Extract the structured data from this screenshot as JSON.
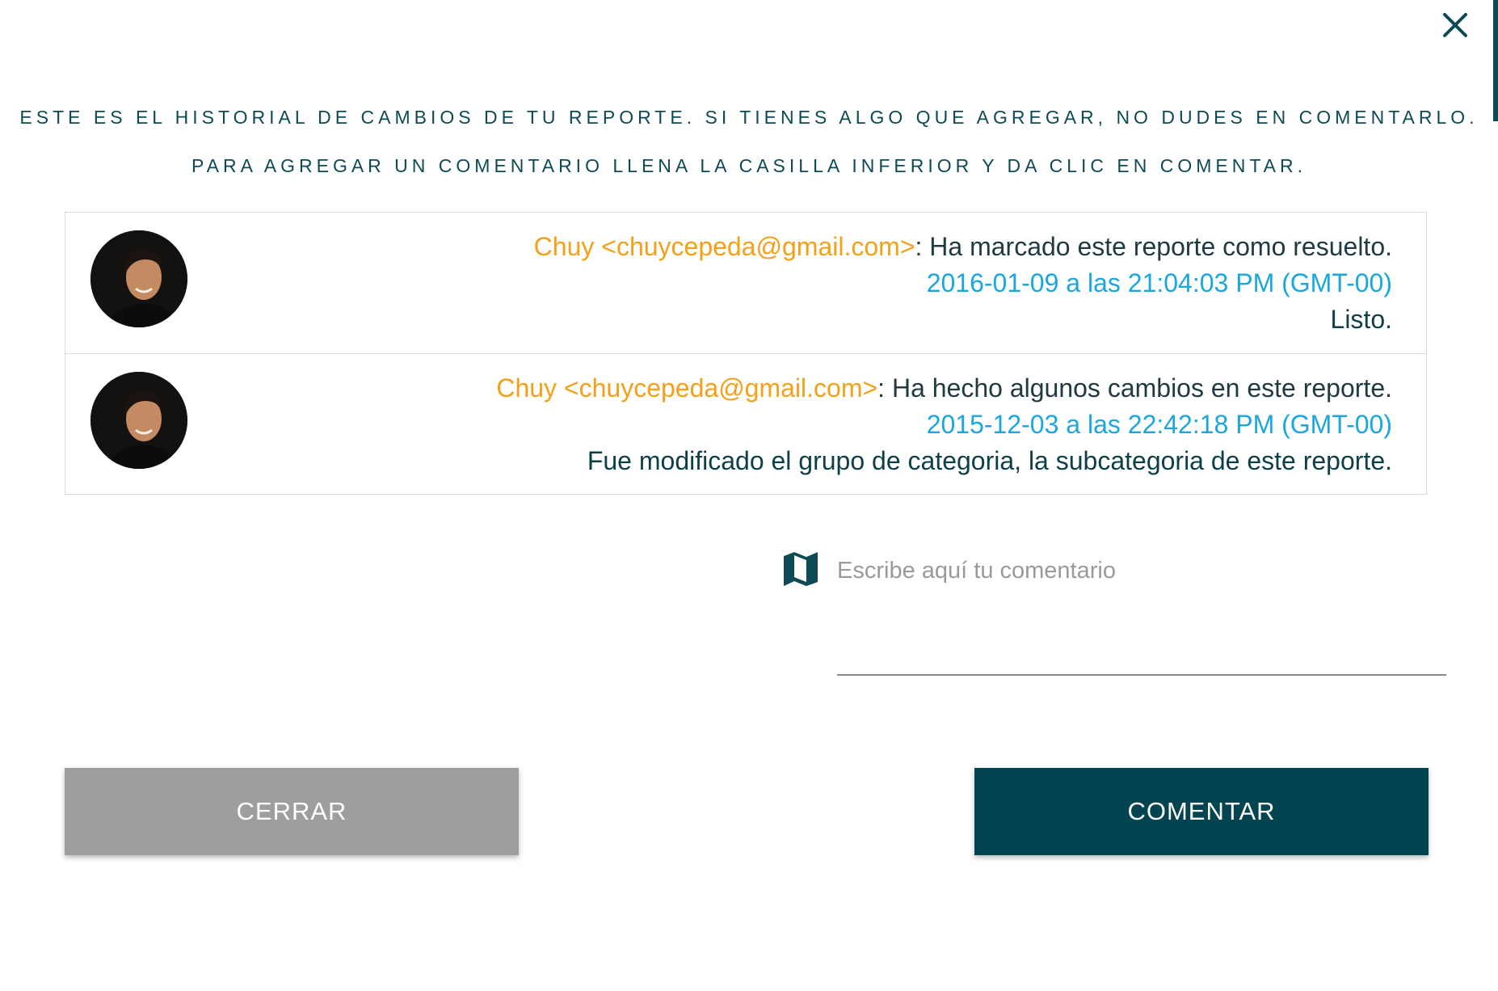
{
  "intro": {
    "line1": "ESTE ES EL HISTORIAL DE CAMBIOS DE TU REPORTE. SI TIENES ALGO QUE AGREGAR, NO DUDES EN COMENTARLO.",
    "line2": "PARA AGREGAR UN COMENTARIO LLENA LA CASILLA INFERIOR Y DA CLIC EN COMENTAR."
  },
  "history": [
    {
      "author": "Chuy <chuycepeda@gmail.com>",
      "action": ": Ha marcado este reporte como resuelto.",
      "timestamp": "2016-01-09 a las 21:04:03 PM (GMT-00)",
      "note": "Listo."
    },
    {
      "author": "Chuy <chuycepeda@gmail.com>",
      "action": ": Ha hecho algunos cambios en este reporte.",
      "timestamp": "2015-12-03 a las 22:42:18 PM (GMT-00)",
      "note": "Fue modificado el grupo de categoria, la subcategoria de este reporte."
    }
  ],
  "comment": {
    "placeholder": "Escribe aquí tu comentario",
    "value": "",
    "icon": "map-icon"
  },
  "buttons": {
    "close_label": "CERRAR",
    "comment_label": "COMENTAR"
  },
  "colors": {
    "primary": "#02444f",
    "author": "#f5a018",
    "timestamp": "#1aa7e0",
    "secondary_button": "#9e9e9e"
  }
}
